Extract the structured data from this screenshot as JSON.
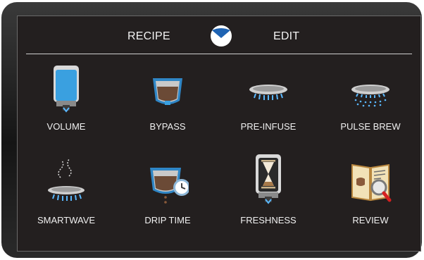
{
  "header": {
    "left_label": "RECIPE",
    "right_label": "EDIT"
  },
  "tiles": [
    {
      "label": "VOLUME",
      "icon": "volume-icon"
    },
    {
      "label": "BYPASS",
      "icon": "bypass-icon"
    },
    {
      "label": "PRE-INFUSE",
      "icon": "pre-infuse-icon"
    },
    {
      "label": "PULSE BREW",
      "icon": "pulse-brew-icon"
    },
    {
      "label": "SMARTWAVE",
      "icon": "smartwave-icon"
    },
    {
      "label": "DRIP TIME",
      "icon": "drip-time-icon"
    },
    {
      "label": "FRESHNESS",
      "icon": "freshness-icon"
    },
    {
      "label": "REVIEW",
      "icon": "review-icon"
    }
  ],
  "colors": {
    "accent": "#1e63b3",
    "water": "#3aa0e0",
    "coffee": "#6b4a36",
    "background": "#231f1f"
  }
}
